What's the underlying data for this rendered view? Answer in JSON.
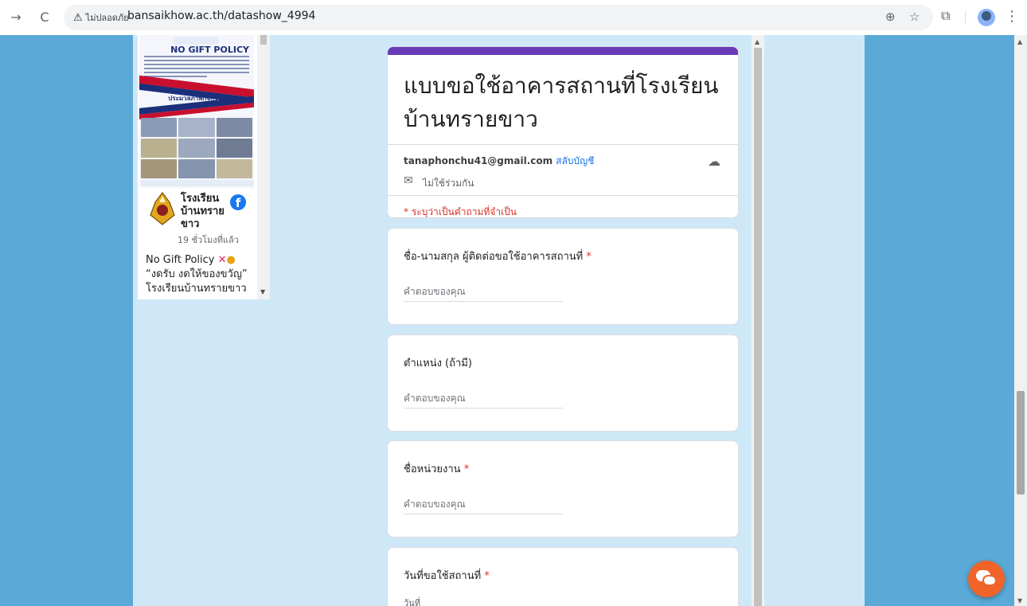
{
  "browser": {
    "security_label": "ไม่ปลอดภัย",
    "url": "bansaikhow.ac.th/datashow_4994",
    "icons": [
      "back-icon",
      "reload-icon",
      "warning-icon",
      "zoom-icon",
      "star-icon",
      "extensions-icon",
      "avatar",
      "more-icon"
    ]
  },
  "facebook_widget": {
    "poster_title": "NO GIFT POLICY",
    "poster_subtitle": "ประมวลภาพกิจกรรม",
    "page_name": "โรงเรียนบ้านทรายขาว",
    "time_ago": "19 ชั่วโมงที่แล้ว",
    "post_line1": "No Gift Policy",
    "post_line2": "“งดรับ งดให้ของขวัญ”",
    "post_line3": "โรงเรียนบ้านทรายขาว"
  },
  "form": {
    "accent_color": "#673ab7",
    "title": "แบบขอใช้อาคารสถานที่โรงเรียนบ้านทรายขาว",
    "email": "tanaphonchu41@gmail.com",
    "switch_account": "สลับบัญชี",
    "not_shared": "ไม่ใช้ร่วมกัน",
    "required_note": "* ระบุว่าเป็นคำถามที่จำเป็น",
    "questions": [
      {
        "label": "ชื่อ-นามสกุล ผู้ติดต่อขอใช้อาคารสถานที่",
        "required": "*",
        "placeholder": "คำตอบของคุณ"
      },
      {
        "label": "ตำแหน่ง (ถ้ามี)",
        "required": "",
        "placeholder": "คำตอบของคุณ"
      },
      {
        "label": "ชื่อหน่วยงาน",
        "required": "*",
        "placeholder": "คำตอบของคุณ"
      },
      {
        "label": "วันที่ขอใช้สถานที่",
        "required": "*",
        "sub_label": "วันที่"
      }
    ]
  },
  "colors": {
    "page_bg": "#5aa9d6",
    "column_bg": "#cfe8f7",
    "required_red": "#d93025",
    "link_blue": "#1a73e8",
    "chat_orange": "#f0642a"
  }
}
